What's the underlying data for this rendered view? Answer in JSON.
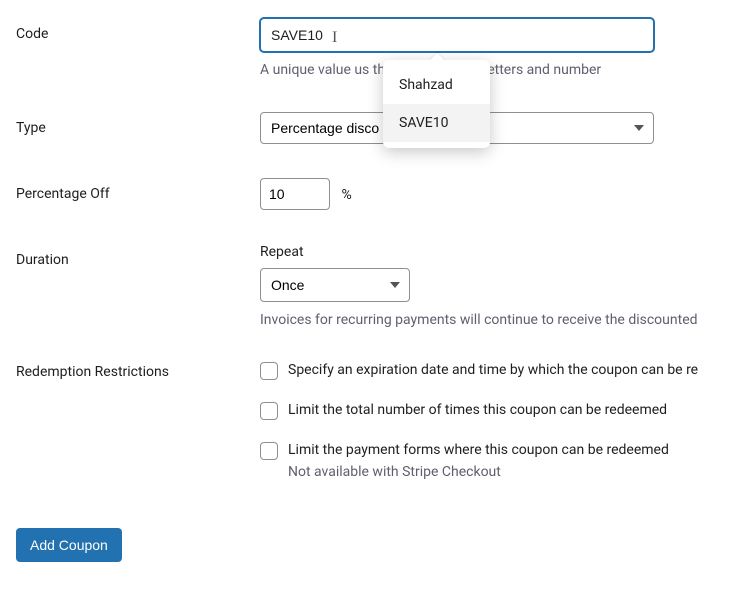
{
  "code": {
    "label": "Code",
    "value": "SAVE10",
    "help": "A unique value us                            the coupon field. Letters and number"
  },
  "autocomplete": {
    "items": [
      "Shahzad",
      "SAVE10"
    ],
    "highlighted_index": 1
  },
  "type": {
    "label": "Type",
    "selected": "Percentage disco"
  },
  "percentage": {
    "label": "Percentage Off",
    "value": "10",
    "symbol": "%"
  },
  "duration": {
    "label": "Duration",
    "sublabel": "Repeat",
    "selected": "Once",
    "help": "Invoices for recurring payments will continue to receive the discounted"
  },
  "restrictions": {
    "label": "Redemption Restrictions",
    "items": [
      {
        "text": "Specify an expiration date and time by which the coupon can be re",
        "sub": ""
      },
      {
        "text": "Limit the total number of times this coupon can be redeemed",
        "sub": ""
      },
      {
        "text": "Limit the payment forms where this coupon can be redeemed",
        "sub": "Not available with Stripe Checkout"
      }
    ]
  },
  "submit": {
    "label": "Add Coupon"
  }
}
